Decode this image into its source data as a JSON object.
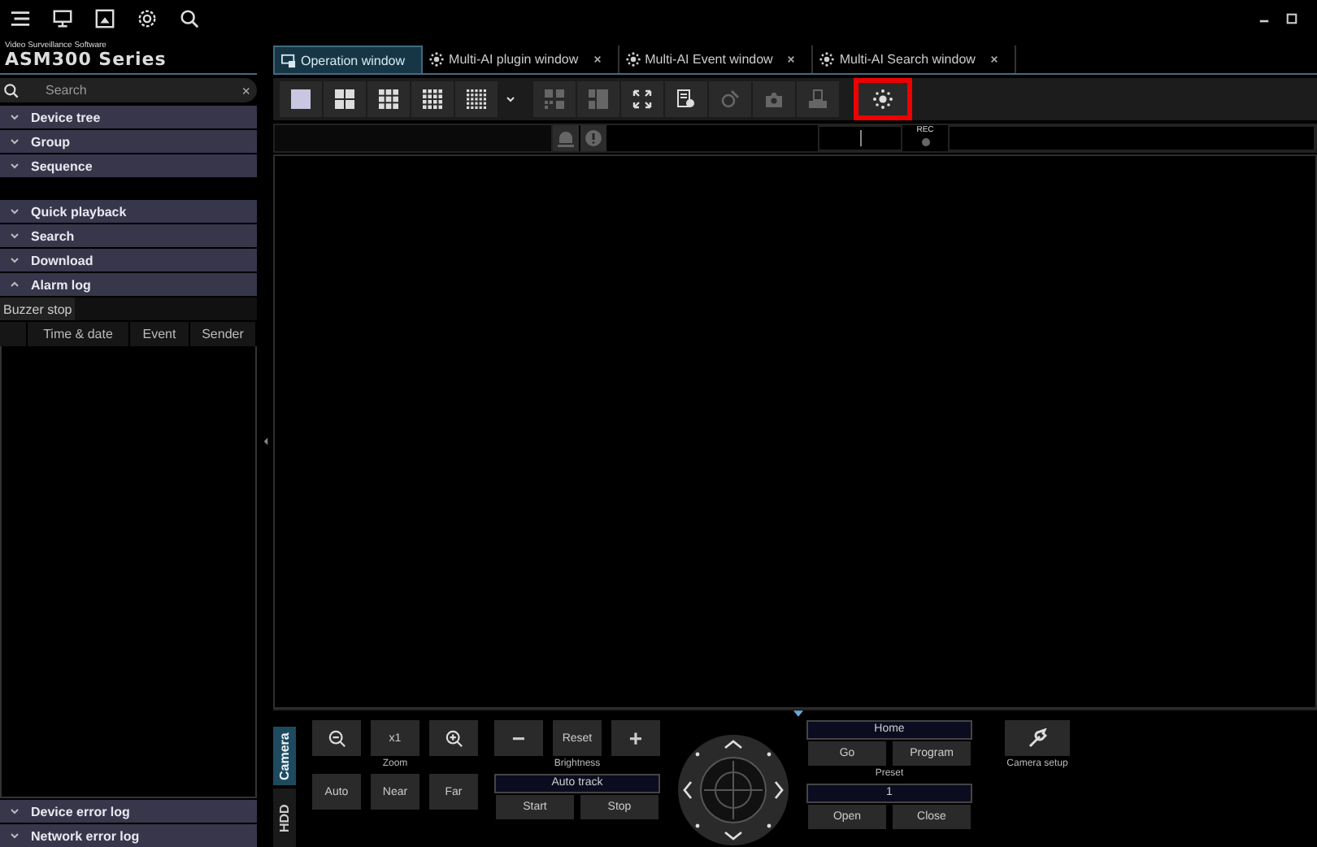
{
  "logo": {
    "subtitle": "Video Surveillance Software",
    "title": "ASM300 Series"
  },
  "search": {
    "placeholder": "Search",
    "clear": "×"
  },
  "sidebar_sections": [
    {
      "label": "Device tree",
      "expanded": false
    },
    {
      "label": "Group",
      "expanded": false
    },
    {
      "label": "Sequence",
      "expanded": false
    },
    {
      "label": "Quick playback",
      "expanded": false
    },
    {
      "label": "Search",
      "expanded": false
    },
    {
      "label": "Download",
      "expanded": false
    },
    {
      "label": "Alarm log",
      "expanded": true
    }
  ],
  "alarm_log": {
    "buzzer_button": "Buzzer stop",
    "columns": [
      "Time & date",
      "Event",
      "Sender"
    ]
  },
  "bottom_sections": [
    {
      "label": "Device error log",
      "expanded": false
    },
    {
      "label": "Network error log",
      "expanded": false
    }
  ],
  "tabs": [
    {
      "label": "Operation window",
      "selected": true,
      "closable": false
    },
    {
      "label": "Multi-AI plugin window",
      "selected": false,
      "closable": true
    },
    {
      "label": "Multi-AI Event window",
      "selected": false,
      "closable": true
    },
    {
      "label": "Multi-AI Search window",
      "selected": false,
      "closable": true
    }
  ],
  "toolbar": [
    {
      "kind": "grid1",
      "disabled": false,
      "highlighted": false
    },
    {
      "kind": "grid4",
      "disabled": false,
      "highlighted": false
    },
    {
      "kind": "grid9",
      "disabled": false,
      "highlighted": false
    },
    {
      "kind": "grid16",
      "disabled": false,
      "highlighted": false
    },
    {
      "kind": "grid25",
      "disabled": false,
      "highlighted": false
    },
    {
      "kind": "dropdown",
      "disabled": false,
      "highlighted": false
    },
    {
      "kind": "sequence",
      "disabled": true,
      "highlighted": false
    },
    {
      "kind": "split",
      "disabled": true,
      "highlighted": false
    },
    {
      "kind": "fullscreen",
      "disabled": false,
      "highlighted": false
    },
    {
      "kind": "settings",
      "disabled": false,
      "highlighted": false
    },
    {
      "kind": "link",
      "disabled": true,
      "highlighted": false
    },
    {
      "kind": "camera",
      "disabled": true,
      "highlighted": false
    },
    {
      "kind": "print",
      "disabled": true,
      "highlighted": false
    },
    {
      "kind": "ai",
      "disabled": false,
      "highlighted": true
    }
  ],
  "status": {
    "rec": "REC"
  },
  "control_tabs": [
    {
      "label": "Camera",
      "selected": true
    },
    {
      "label": "HDD",
      "selected": false
    }
  ],
  "zoom": {
    "label": "Zoom",
    "reset": "x1",
    "focus": [
      "Auto",
      "Near",
      "Far"
    ]
  },
  "brightness": {
    "minus": "−",
    "reset": "Reset",
    "plus": "+",
    "label": "Brightness",
    "auto_track": "Auto track",
    "start": "Start",
    "stop": "Stop"
  },
  "preset": {
    "value": "Home",
    "go": "Go",
    "program": "Program",
    "label": "Preset",
    "aux_value": "1",
    "open": "Open",
    "close": "Close"
  },
  "camera_setup": {
    "label": "Camera setup"
  }
}
